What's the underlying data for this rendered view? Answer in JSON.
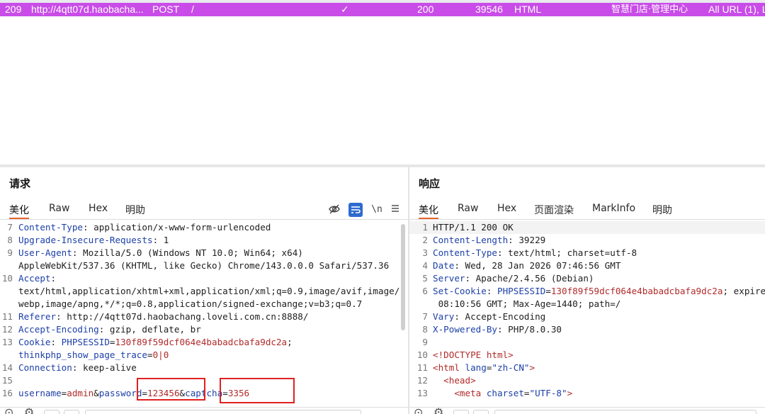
{
  "history": {
    "row": {
      "num": "209",
      "host": "http://4qtt07d.haobacha...",
      "method": "POST",
      "url": "/",
      "check": "✓",
      "status": "200",
      "length": "39546",
      "mime": "HTML",
      "title": "智慧门店·管理中心",
      "notes": "All URL (1), L"
    },
    "row_color": "#c94ce8"
  },
  "request": {
    "title": "请求",
    "tabs": [
      "美化",
      "Raw",
      "Hex",
      "明助"
    ],
    "icons": [
      "eye-off-icon",
      "wrap-lines-icon",
      "newline-icon",
      "menu-icon"
    ],
    "newline_label": "\\n",
    "lines": [
      {
        "n": "7",
        "key": "Content-Type",
        "sep": ": ",
        "val": "application/x-www-form-urlencoded"
      },
      {
        "n": "8",
        "key": "Upgrade-Insecure-Requests",
        "sep": ": ",
        "val": "1"
      },
      {
        "n": "9",
        "key": "User-Agent",
        "sep": ": ",
        "val": "Mozilla/5.0 (Windows NT 10.0; Win64; x64)"
      },
      {
        "n": "",
        "key": "",
        "sep": "",
        "val": "AppleWebKit/537.36 (KHTML, like Gecko) Chrome/143.0.0.0 Safari/537.36"
      },
      {
        "n": "10",
        "key": "Accept",
        "sep": ":",
        "val": ""
      },
      {
        "n": "",
        "key": "",
        "sep": "",
        "val": "text/html,application/xhtml+xml,application/xml;q=0.9,image/avif,image/"
      },
      {
        "n": "",
        "key": "",
        "sep": "",
        "val": "webp,image/apng,*/*;q=0.8,application/signed-exchange;v=b3;q=0.7"
      },
      {
        "n": "11",
        "key": "Referer",
        "sep": ": ",
        "val": "http://4qtt07d.haobachang.loveli.com.cn:8888/"
      },
      {
        "n": "12",
        "key": "Accept-Encoding",
        "sep": ": ",
        "val": "gzip, deflate, br"
      },
      {
        "n": "13",
        "key": "Cookie",
        "sep": ": ",
        "val": ""
      },
      {
        "n": "",
        "key": "",
        "sep": "",
        "val": ""
      },
      {
        "n": "14",
        "key": "Connection",
        "sep": ": ",
        "val": "keep-alive"
      },
      {
        "n": "15",
        "key": "",
        "sep": "",
        "val": ""
      }
    ],
    "cookie": {
      "name1": "PHPSESSID",
      "value1": "130f89f59dcf064e4babadcbafa9dc2a",
      "name2": "thinkphp_show_page_trace",
      "value2": "0|0"
    },
    "body": {
      "n": "16",
      "k1": "username",
      "v1": "admin",
      "k2": "password",
      "v2": "123456",
      "k3": "captcha",
      "v3": "3356"
    }
  },
  "response": {
    "title": "响应",
    "tabs": [
      "美化",
      "Raw",
      "Hex",
      "页面渲染",
      "MarkInfo",
      "明助"
    ],
    "lines": [
      {
        "n": "1",
        "key": "",
        "sep": "",
        "val": "HTTP/1.1 200 OK"
      },
      {
        "n": "2",
        "key": "Content-Length",
        "sep": ": ",
        "val": "39229"
      },
      {
        "n": "3",
        "key": "Content-Type",
        "sep": ": ",
        "val": "text/html; charset=utf-8"
      },
      {
        "n": "4",
        "key": "Date",
        "sep": ": ",
        "val": "Wed, 28 Jan 2026 07:46:56 GMT"
      },
      {
        "n": "5",
        "key": "Server",
        "sep": ": ",
        "val": "Apache/2.4.56 (Debian)"
      },
      {
        "n": "6",
        "key": "Set-Cookie",
        "sep": ": ",
        "val": ""
      },
      {
        "n": "",
        "key": "",
        "sep": "",
        "val": " 08:10:56 GMT; Max-Age=1440; path=/"
      },
      {
        "n": "7",
        "key": "Vary",
        "sep": ": ",
        "val": "Accept-Encoding"
      },
      {
        "n": "8",
        "key": "X-Powered-By",
        "sep": ": ",
        "val": "PHP/8.0.30"
      },
      {
        "n": "9",
        "key": "",
        "sep": "",
        "val": ""
      },
      {
        "n": "10",
        "key": "",
        "sep": "",
        "val": "<!DOCTYPE html>"
      },
      {
        "n": "11",
        "key": "",
        "sep": "",
        "val": ""
      },
      {
        "n": "12",
        "key": "",
        "sep": "",
        "val": ""
      },
      {
        "n": "13",
        "key": "",
        "sep": "",
        "val": ""
      }
    ],
    "set_cookie": {
      "name": "PHPSESSID",
      "value": "130f89f59dcf064e4babadcbafa9dc2a",
      "rest": "; expire"
    },
    "html_tag": {
      "open": "<html ",
      "attr": "lang",
      "eq": "=",
      "val": "\"zh-CN\"",
      "close": ">"
    },
    "head_tag": "<head>",
    "meta_tag": {
      "open": "<meta ",
      "attr": "charset",
      "eq": "=",
      "val": "\"UTF-8\"",
      "close": ">"
    }
  },
  "colors": {
    "accent": "#e8642a",
    "key": "#1c3fa8",
    "value_red": "#b22a2a",
    "highlight_box": "#e02020"
  }
}
